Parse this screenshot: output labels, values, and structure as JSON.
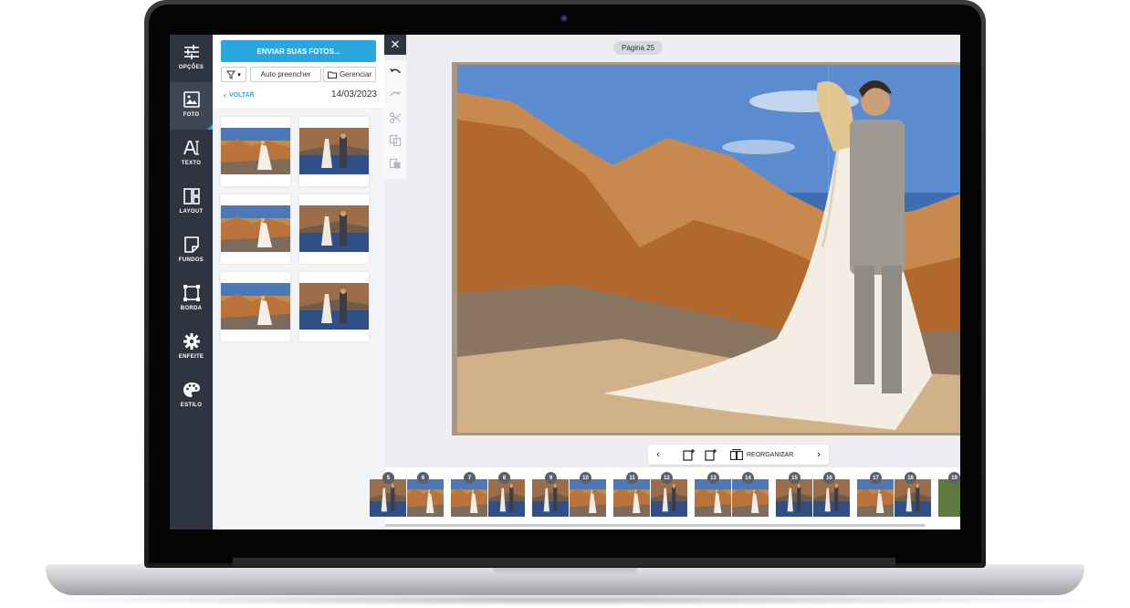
{
  "sidebar": {
    "items": [
      {
        "label": "OPÇÕES",
        "icon": "sliders-icon"
      },
      {
        "label": "FOTO",
        "icon": "image-icon"
      },
      {
        "label": "TEXTO",
        "icon": "text-icon"
      },
      {
        "label": "LAYOUT",
        "icon": "layout-icon"
      },
      {
        "label": "FUNDOS",
        "icon": "background-icon"
      },
      {
        "label": "BORDA",
        "icon": "border-icon"
      },
      {
        "label": "ENFEITE",
        "icon": "gear-icon"
      },
      {
        "label": "ESTILO",
        "icon": "palette-icon"
      }
    ],
    "active": "FOTO"
  },
  "photo_panel": {
    "upload_label": "ENVIAR SUAS FOTOS...",
    "auto_fill_label": "Auto preencher",
    "manage_label": "Gerenciar",
    "back_label": "VOLTAR",
    "date": "14/03/2023"
  },
  "editor": {
    "page_label": "Página 25"
  },
  "page_nav": {
    "reorganize_label": "REORGANIZAR"
  },
  "page_strip": {
    "pages": [
      {
        "left": "5",
        "right": "6"
      },
      {
        "left": "7",
        "right": "8"
      },
      {
        "left": "9",
        "right": "10"
      },
      {
        "left": "11",
        "right": "12"
      },
      {
        "left": "13",
        "right": "14"
      },
      {
        "left": "15",
        "right": "16"
      },
      {
        "left": "17",
        "right": "18"
      },
      {
        "left": "19",
        "right": ""
      }
    ]
  },
  "colors": {
    "accent": "#29a8e0",
    "toolbar": "#2e3440"
  }
}
